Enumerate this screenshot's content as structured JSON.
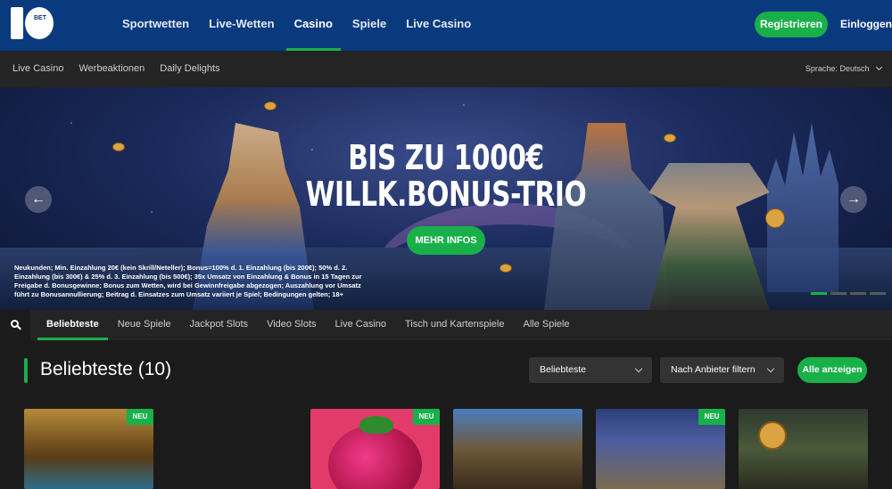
{
  "header": {
    "logo_text": "BET",
    "nav": [
      "Sportwetten",
      "Live-Wetten",
      "Casino",
      "Spiele",
      "Live Casino"
    ],
    "active_nav": "Casino",
    "register_label": "Registrieren",
    "login_label": "Einloggen"
  },
  "subnav": {
    "links": [
      "Live Casino",
      "Werbeaktionen",
      "Daily Delights"
    ],
    "language_label": "Sprache:",
    "language_value": "Deutsch"
  },
  "hero": {
    "title_line1": "BIS ZU 1000€",
    "title_line2": "WILLK.BONUS-TRIO",
    "button_label": "MEHR INFOS",
    "terms": "Neukunden; Min. Einzahlung 20€ (kein Skrill/Neteller); Bonus=100% d. 1. Einzahlung (bis 200€); 50% d. 2. Einzahlung (bis 300€) & 25% d. 3. Einzahlung (bis 500€); 35x Umsatz von Einzahlung & Bonus in 15 Tagen zur Freigabe d. Bonusgewinne; Bonus zum Wetten, wird bei Gewinnfreigabe abgezogen; Auszahlung vor Umsatz führt zu Bonusannullierung; Beitrag d. Einsatzes zum Umsatz variiert je Spiel; Bedingungen gelten; 18+",
    "slides_count": 4,
    "active_slide": 1
  },
  "categories": {
    "items": [
      "Beliebteste",
      "Neue Spiele",
      "Jackpot Slots",
      "Video Slots",
      "Live Casino",
      "Tisch und Kartenspiele",
      "Alle Spiele"
    ],
    "active": "Beliebteste"
  },
  "section": {
    "title": "Beliebteste (10)",
    "sort_select": "Beliebteste",
    "provider_select": "Nach Anbieter filtern",
    "show_all_label": "Alle anzeigen"
  },
  "games": [
    {
      "badge": "NEU"
    },
    {
      "badge": "NEU"
    },
    {
      "badge": ""
    },
    {
      "badge": "NEU"
    },
    {
      "badge": ""
    }
  ],
  "colors": {
    "nav_bg": "#0a3a7e",
    "accent_green": "#19b04a",
    "dark_bg": "#1b1b1b",
    "bar_bg": "#242424"
  }
}
